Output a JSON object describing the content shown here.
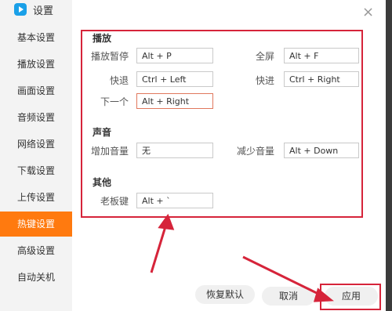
{
  "window": {
    "title": "设置",
    "close_symbol": "×"
  },
  "sidebar": {
    "items": [
      {
        "label": "基本设置"
      },
      {
        "label": "播放设置"
      },
      {
        "label": "画面设置"
      },
      {
        "label": "音频设置"
      },
      {
        "label": "网络设置"
      },
      {
        "label": "下载设置"
      },
      {
        "label": "上传设置"
      },
      {
        "label": "热键设置",
        "active": true
      },
      {
        "label": "高级设置"
      },
      {
        "label": "自动关机"
      }
    ]
  },
  "sections": {
    "playback": {
      "title": "播放",
      "play_pause": {
        "label": "播放暂停",
        "value": "Alt + P"
      },
      "fullscreen": {
        "label": "全屏",
        "value": "Alt + F"
      },
      "rewind": {
        "label": "快退",
        "value": "Ctrl + Left"
      },
      "forward": {
        "label": "快进",
        "value": "Ctrl + Right"
      },
      "next": {
        "label": "下一个",
        "value": "Alt + Right"
      }
    },
    "sound": {
      "title": "声音",
      "vol_up": {
        "label": "增加音量",
        "value": "无"
      },
      "vol_down": {
        "label": "减少音量",
        "value": "Alt + Down"
      }
    },
    "other": {
      "title": "其他",
      "boss_key": {
        "label": "老板键",
        "value": "Alt + `"
      }
    }
  },
  "footer": {
    "restore_label": "恢复默认",
    "cancel_label": "取消",
    "apply_label": "应用"
  },
  "colors": {
    "accent": "#ff7a0f",
    "annotation": "#d6243a"
  }
}
